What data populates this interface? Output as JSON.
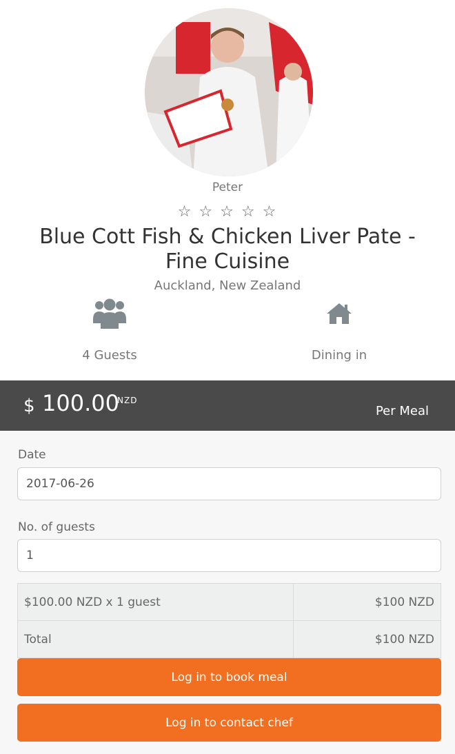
{
  "chef": {
    "name": "Peter",
    "rating_stars": [
      "☆",
      "☆",
      "☆",
      "☆",
      "☆"
    ]
  },
  "meal": {
    "title": "Blue Cott Fish & Chicken Liver Pate - Fine Cuisine",
    "location": "Auckland, New Zealand"
  },
  "features": {
    "guests_icon": "users-icon",
    "guests_label": "4 Guests",
    "dining_icon": "home-icon",
    "dining_label": "Dining in"
  },
  "price": {
    "currency_symbol": "$",
    "amount": "100.00",
    "currency_code": "NZD",
    "unit": "Per Meal"
  },
  "form": {
    "date_label": "Date",
    "date_value": "2017-06-26",
    "guests_label": "No. of guests",
    "guests_value": "1"
  },
  "summary": {
    "rows": [
      {
        "label": "$100.00 NZD x 1 guest",
        "value": "$100 NZD"
      },
      {
        "label": "Total",
        "value": "$100 NZD"
      }
    ]
  },
  "actions": {
    "book_label": "Log in to book meal",
    "contact_label": "Log in to contact chef"
  },
  "colors": {
    "accent": "#f26f21",
    "price_bar": "#4a4a4a",
    "icon_gray": "#808a8e"
  }
}
